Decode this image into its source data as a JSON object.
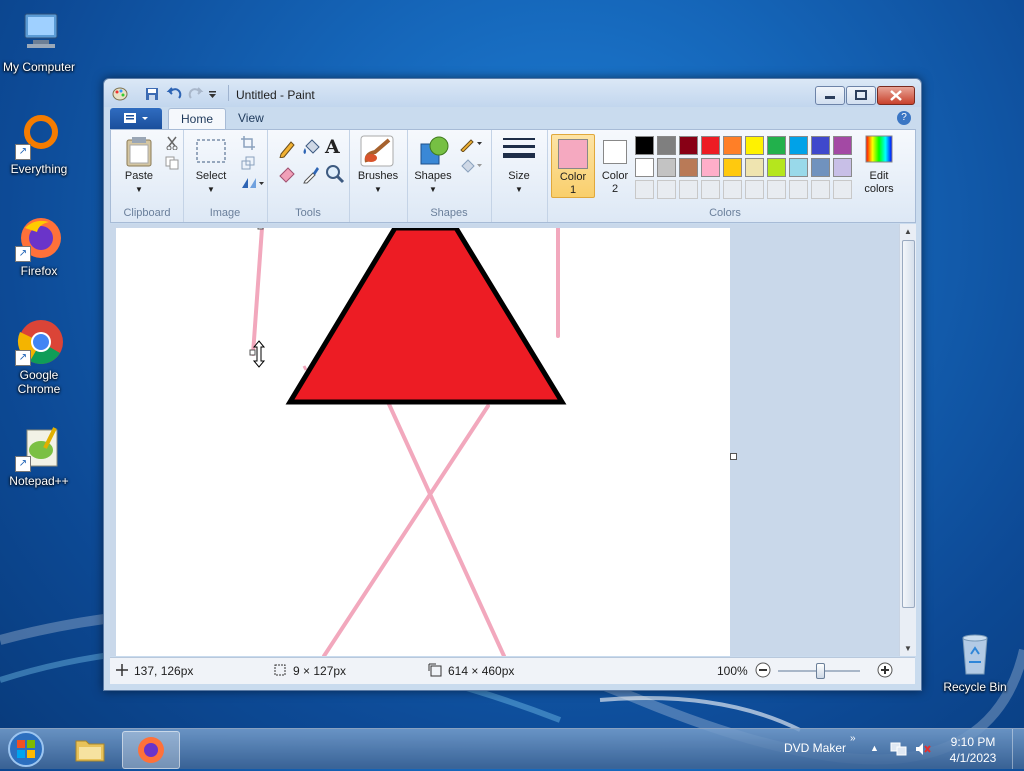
{
  "desktop": {
    "icons": [
      {
        "label": "My Computer"
      },
      {
        "label": "Everything"
      },
      {
        "label": "Firefox"
      },
      {
        "label": "Google Chrome"
      },
      {
        "label": "Notepad++"
      },
      {
        "label": "Recycle Bin"
      }
    ]
  },
  "window": {
    "title": "Untitled - Paint",
    "tabs": [
      {
        "label": "Home"
      },
      {
        "label": "View"
      }
    ],
    "groups": {
      "clipboard": {
        "label": "Clipboard",
        "paste": "Paste"
      },
      "image": {
        "label": "Image",
        "select": "Select"
      },
      "tools": {
        "label": "Tools"
      },
      "brushes": {
        "label": "Brushes"
      },
      "shapes": {
        "label": "Shapes",
        "shapes_btn": "Shapes"
      },
      "size": {
        "label": "Size"
      },
      "colors": {
        "label": "Colors",
        "color1": "Color 1",
        "color1_a": "Color",
        "color1_b": "1",
        "color2_a": "Color",
        "color2_b": "2",
        "edit_a": "Edit",
        "edit_b": "colors",
        "color1_value": "#f5a9c0",
        "color2_value": "#ffffff",
        "palette_row1": [
          "#000000",
          "#7f7f7f",
          "#880015",
          "#ed1c24",
          "#ff7f27",
          "#fff200",
          "#22b14c",
          "#00a2e8",
          "#3f48cc",
          "#a349a4"
        ],
        "palette_row2": [
          "#ffffff",
          "#c3c3c3",
          "#b97a57",
          "#ffaec9",
          "#ffc90e",
          "#efe4b0",
          "#b5e61d",
          "#99d9ea",
          "#7092be",
          "#c8bfe7"
        ]
      }
    },
    "status": {
      "cursor_pos": "137, 126px",
      "selection_size": "9 × 127px",
      "image_size": "614 × 460px",
      "zoom": "100%"
    }
  },
  "taskbar": {
    "toolbar_label": "DVD Maker",
    "time": "9:10 PM",
    "date": "4/1/2023"
  }
}
